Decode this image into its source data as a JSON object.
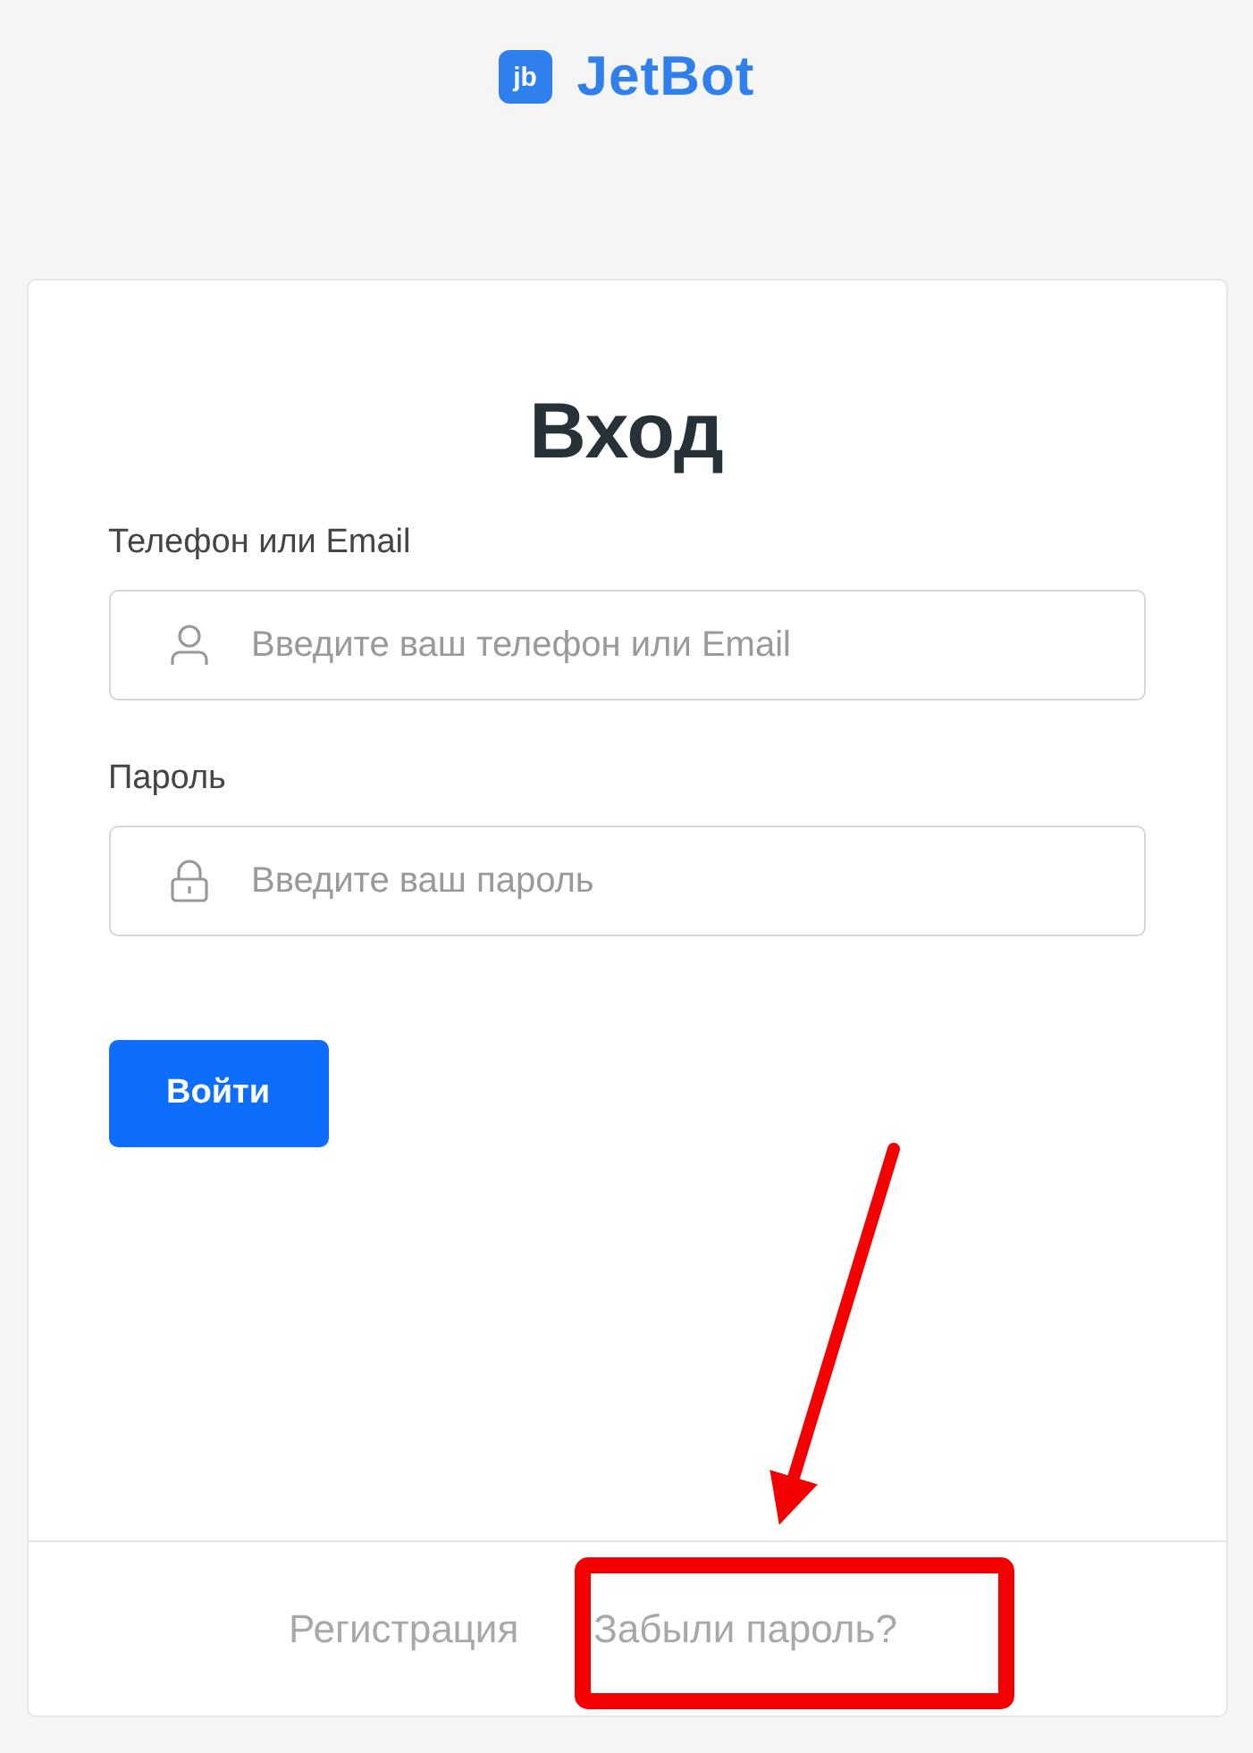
{
  "logo": {
    "mark": "jb",
    "name": "JetBot"
  },
  "title": "Вход",
  "fields": [
    {
      "label": "Телефон или Email",
      "placeholder": "Введите ваш телефон или Email",
      "kind": "user"
    },
    {
      "label": "Пароль",
      "placeholder": "Введите ваш пароль",
      "kind": "lock"
    }
  ],
  "submit": "Войти",
  "footer_links": [
    "Регистрация",
    "Забыли пароль?"
  ],
  "annotation": {
    "kind": "arrow-box"
  }
}
